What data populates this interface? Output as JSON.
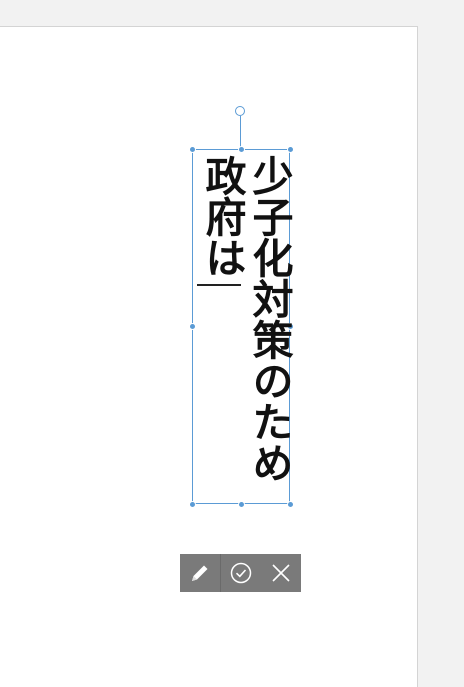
{
  "editor": {
    "text_line_1": "少子化対策のため",
    "text_line_2": "政府は"
  },
  "toolbar": {
    "edit_icon": "pencil-icon",
    "confirm_icon": "check-circle-icon",
    "cancel_icon": "close-icon"
  },
  "colors": {
    "selection": "#5b9bd5",
    "toolbar_bg": "#7a7a7a",
    "text": "#111111"
  }
}
